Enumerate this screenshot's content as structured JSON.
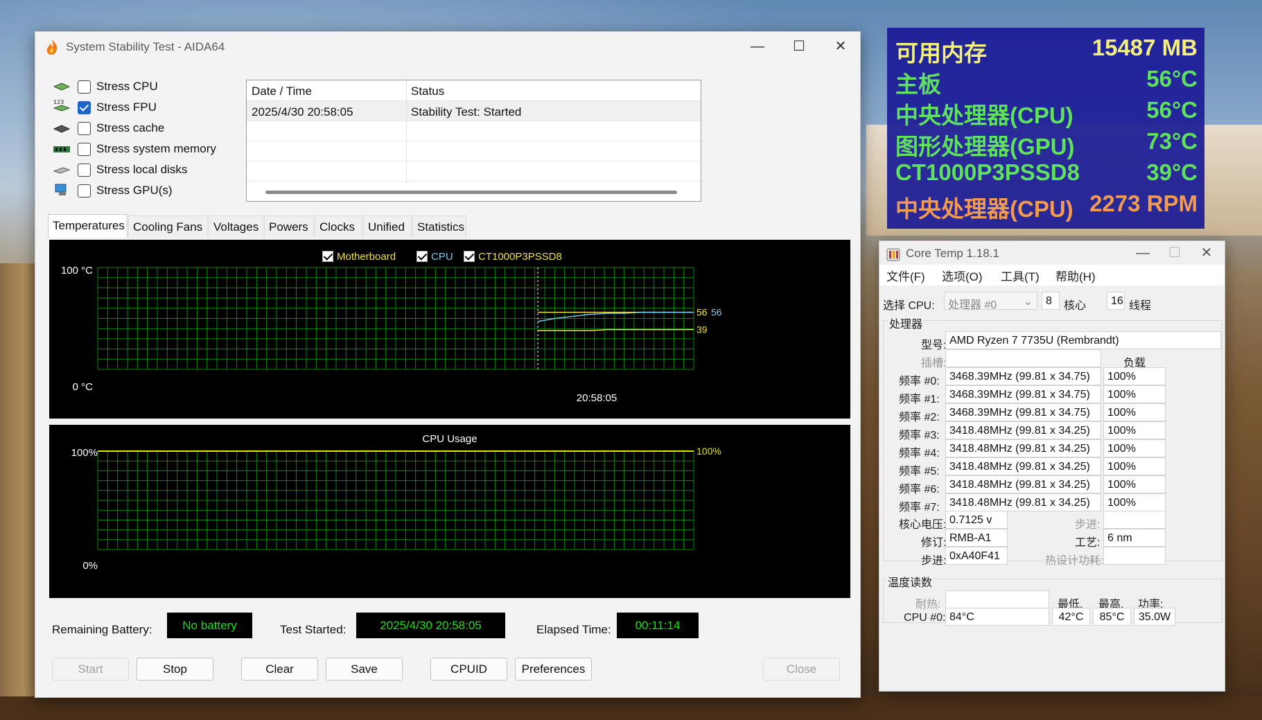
{
  "aida": {
    "title": "System Stability Test - AIDA64",
    "window_controls": {
      "minimize": "—",
      "maximize": "☐",
      "close": "✕"
    },
    "stress": [
      {
        "label": "Stress CPU",
        "checked": false,
        "icon": "cpu-chip-icon"
      },
      {
        "label": "Stress FPU",
        "checked": true,
        "icon": "fpu-123-icon"
      },
      {
        "label": "Stress cache",
        "checked": false,
        "icon": "cache-chip-icon"
      },
      {
        "label": "Stress system memory",
        "checked": false,
        "icon": "memory-module-icon"
      },
      {
        "label": "Stress local disks",
        "checked": false,
        "icon": "disk-drive-icon"
      },
      {
        "label": "Stress GPU(s)",
        "checked": false,
        "icon": "gpu-monitor-icon"
      }
    ],
    "log": {
      "headers": [
        "Date / Time",
        "Status"
      ],
      "rows": [
        [
          "2025/4/30 20:58:05",
          "Stability Test: Started"
        ]
      ]
    },
    "tabs": [
      "Temperatures",
      "Cooling Fans",
      "Voltages",
      "Powers",
      "Clocks",
      "Unified",
      "Statistics"
    ],
    "active_tab": "Temperatures",
    "temp_legend": [
      {
        "label": "Motherboard",
        "color": "#f0e040"
      },
      {
        "label": "CPU",
        "color": "#7ec8ea"
      },
      {
        "label": "CT1000P3PSSD8",
        "color": "#f0e040"
      }
    ],
    "temp_axis": {
      "top": "100 °C",
      "bottom": "0 °C",
      "time": "20:58:05"
    },
    "cpu_usage_title": "CPU Usage",
    "usage_axis": {
      "top": "100%",
      "bottom": "0%"
    },
    "info": {
      "battery_label": "Remaining Battery:",
      "battery_value": "No battery",
      "started_label": "Test Started:",
      "started_value": "2025/4/30 20:58:05",
      "elapsed_label": "Elapsed Time:",
      "elapsed_value": "00:11:14"
    },
    "buttons": {
      "start": "Start",
      "stop": "Stop",
      "clear": "Clear",
      "save": "Save",
      "cpuid": "CPUID",
      "preferences": "Preferences",
      "close": "Close"
    }
  },
  "chart_data": [
    {
      "type": "line",
      "title": "",
      "ylim": [
        0,
        100
      ],
      "ylabel": "°C",
      "xlabel": "",
      "grid": true,
      "legend": "top-center",
      "x_tick_labels": [
        "20:58:05"
      ],
      "series": [
        {
          "name": "Motherboard",
          "color": "#f0e040",
          "values": [
            56,
            56,
            56,
            56,
            56,
            56,
            56,
            56,
            56,
            56
          ],
          "end_label": "56"
        },
        {
          "name": "CPU",
          "color": "#7ec8ea",
          "values": [
            47,
            50,
            52,
            54,
            55,
            55,
            56,
            56,
            56,
            56
          ],
          "end_label": "56"
        },
        {
          "name": "CT1000P3PSSD8",
          "color": "#f0e040",
          "values": [
            38,
            38,
            38,
            38,
            39,
            39,
            39,
            39,
            39,
            39
          ],
          "end_label": "39"
        }
      ]
    },
    {
      "type": "line",
      "title": "CPU Usage",
      "ylim": [
        0,
        100
      ],
      "ylabel": "%",
      "xlabel": "",
      "grid": true,
      "series": [
        {
          "name": "",
          "color": "#e6e600",
          "values": [
            100,
            100,
            100,
            100,
            100,
            100,
            100,
            100,
            100,
            100
          ],
          "end_label": "100%"
        }
      ]
    }
  ],
  "osd": {
    "rows": [
      {
        "key": "可用内存",
        "value": "15487 MB",
        "kcolor": "#f3ee80",
        "vcolor": "#f3ee80"
      },
      {
        "key": "主板",
        "value": "56°C",
        "kcolor": "#5fe05f",
        "vcolor": "#5fe05f"
      },
      {
        "key": "中央处理器(CPU)",
        "value": "56°C",
        "kcolor": "#5fe05f",
        "vcolor": "#5fe05f"
      },
      {
        "key": "图形处理器(GPU)",
        "value": "73°C",
        "kcolor": "#5fe05f",
        "vcolor": "#5fe05f"
      },
      {
        "key": "CT1000P3PSSD8",
        "value": "39°C",
        "kcolor": "#5fe05f",
        "vcolor": "#5fe05f"
      },
      {
        "key": "中央处理器(CPU)",
        "value": "2273 RPM",
        "kcolor": "#f29a52",
        "vcolor": "#f29a52"
      }
    ]
  },
  "coretemp": {
    "title": "Core Temp 1.18.1",
    "menu": [
      "文件(F)",
      "选项(O)",
      "工具(T)",
      "帮助(H)"
    ],
    "select_cpu_label": "选择 CPU:",
    "processor_select": "处理器 #0",
    "cores": "8",
    "cores_label": "核心",
    "threads": "16",
    "threads_label": "线程",
    "processor_group": "处理器",
    "model_label": "型号:",
    "model": "AMD Ryzen 7 7735U (Rembrandt)",
    "socket_label": "插槽:",
    "socket": "",
    "load_label": "负载",
    "freqs": [
      {
        "label": "频率 #0:",
        "value": "3468.39MHz (99.81 x 34.75)",
        "load": "100%"
      },
      {
        "label": "频率 #1:",
        "value": "3468.39MHz (99.81 x 34.75)",
        "load": "100%"
      },
      {
        "label": "频率 #2:",
        "value": "3468.39MHz (99.81 x 34.75)",
        "load": "100%"
      },
      {
        "label": "频率 #3:",
        "value": "3418.48MHz (99.81 x 34.25)",
        "load": "100%"
      },
      {
        "label": "频率 #4:",
        "value": "3418.48MHz (99.81 x 34.25)",
        "load": "100%"
      },
      {
        "label": "频率 #5:",
        "value": "3418.48MHz (99.81 x 34.25)",
        "load": "100%"
      },
      {
        "label": "频率 #6:",
        "value": "3418.48MHz (99.81 x 34.25)",
        "load": "100%"
      },
      {
        "label": "频率 #7:",
        "value": "3418.48MHz (99.81 x 34.25)",
        "load": "100%"
      }
    ],
    "vcore_label": "核心电压:",
    "vcore": "0.7125 v",
    "step_label": "步进:",
    "step_value": "",
    "revision_label": "修订:",
    "revision": "RMB-A1",
    "lithography_label": "工艺:",
    "lithography": "6 nm",
    "stepping_label": "步进:",
    "stepping": "0xA40F41",
    "tdp_label": "热设计功耗:",
    "tdp": "",
    "temp_group": "温度读数",
    "tjmax_label": "耐热:",
    "tjmax": "",
    "min_label": "最低.",
    "max_label": "最高.",
    "power_label": "功率:",
    "cpu0_label": "CPU #0:",
    "cpu0_temp": "84°C",
    "cpu0_min": "42°C",
    "cpu0_max": "85°C",
    "cpu0_power": "35.0W"
  }
}
